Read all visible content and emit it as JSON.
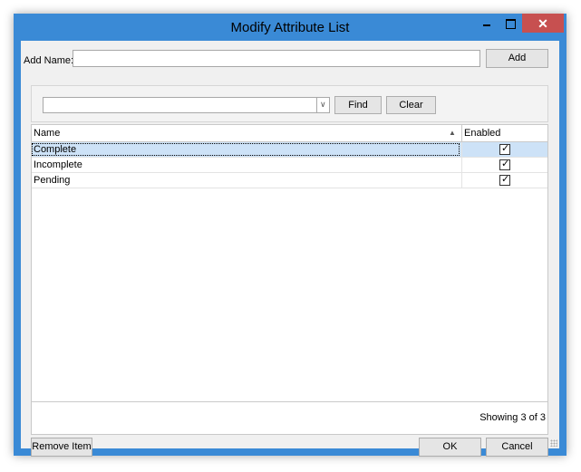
{
  "window": {
    "title": "Modify Attribute List",
    "minimize_icon": "minimize-icon",
    "maximize_icon": "maximize-icon",
    "close_icon": "close-icon",
    "close_glyph": "✕"
  },
  "add": {
    "label": "Add Name:",
    "value": "",
    "button_label": "Add"
  },
  "find": {
    "search_value": "",
    "find_label": "Find",
    "clear_label": "Clear"
  },
  "grid": {
    "columns": [
      "Name",
      "Enabled"
    ],
    "sort_indicator": "▲",
    "rows": [
      {
        "name": "Complete",
        "enabled": true,
        "selected": true
      },
      {
        "name": "Incomplete",
        "enabled": true,
        "selected": false
      },
      {
        "name": "Pending",
        "enabled": true,
        "selected": false
      }
    ],
    "status": "Showing 3 of 3"
  },
  "buttons": {
    "remove_label": "Remove Item",
    "ok_label": "OK",
    "cancel_label": "Cancel"
  },
  "colors": {
    "window_frame": "#3a8ad6",
    "close_button": "#c75050",
    "selection": "#cde2f7"
  }
}
